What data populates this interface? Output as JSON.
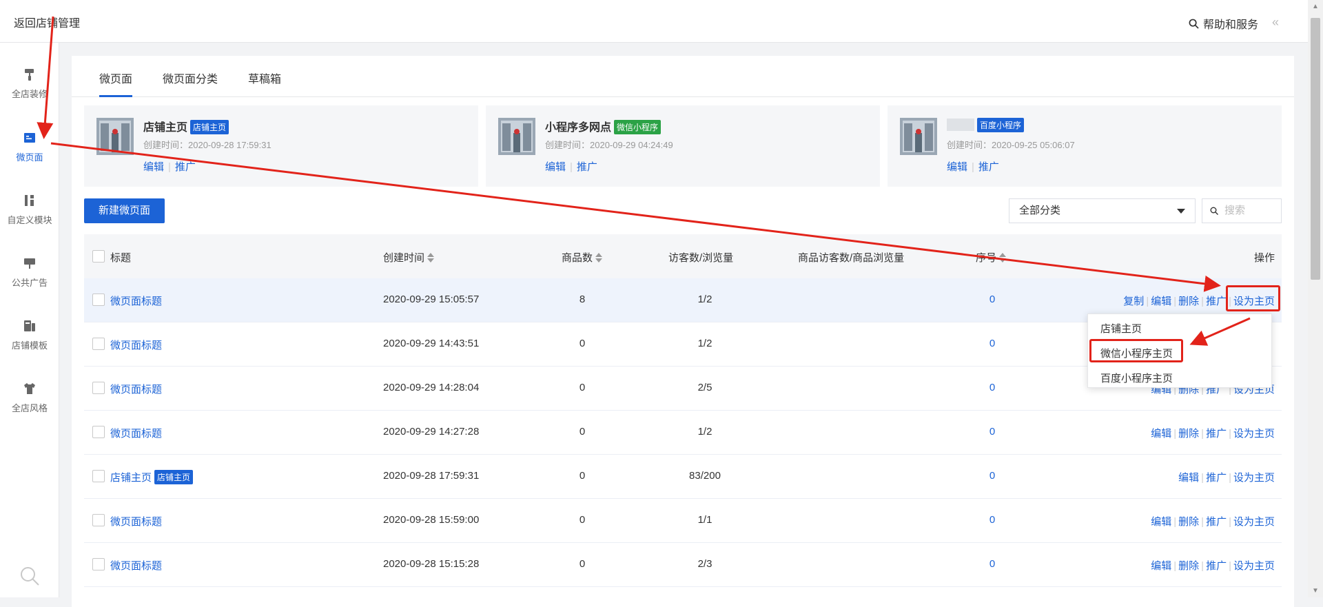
{
  "header": {
    "back_label": "返回店铺管理",
    "help_label": "帮助和服务",
    "collapse_glyph": "«"
  },
  "sidebar": {
    "items": [
      {
        "label": "全店装修",
        "icon": "paint-roller-icon"
      },
      {
        "label": "微页面",
        "icon": "page-icon"
      },
      {
        "label": "自定义模块",
        "icon": "module-icon"
      },
      {
        "label": "公共广告",
        "icon": "billboard-icon"
      },
      {
        "label": "店铺模板",
        "icon": "template-icon"
      },
      {
        "label": "全店风格",
        "icon": "shirt-icon"
      }
    ],
    "active_index": 1
  },
  "tabs": [
    {
      "label": "微页面"
    },
    {
      "label": "微页面分类"
    },
    {
      "label": "草稿箱"
    }
  ],
  "home_cards": [
    {
      "name": "店铺主页",
      "badge": "店铺主页",
      "badge_color": "#1c63d6",
      "created": "创建时间：2020-09-28 17:59:31",
      "edit": "编辑",
      "promote": "推广"
    },
    {
      "name": "小程序多网点",
      "badge": "微信小程序",
      "badge_color": "#2ba246",
      "created": "创建时间：2020-09-29 04:24:49",
      "edit": "编辑",
      "promote": "推广"
    },
    {
      "name": "",
      "badge": "百度小程序",
      "badge_color": "#1c63d6",
      "created": "创建时间：2020-09-25 05:06:07",
      "edit": "编辑",
      "promote": "推广"
    }
  ],
  "toolbar": {
    "new_label": "新建微页面",
    "category_selected": "全部分类",
    "search_placeholder": "搜索"
  },
  "table": {
    "headers": {
      "title": "标题",
      "created": "创建时间",
      "goods": "商品数",
      "visitors": "访客数/浏览量",
      "goods_visitors": "商品访客数/商品浏览量",
      "order": "序号",
      "ops": "操作"
    },
    "rows": [
      {
        "title": "微页面标题",
        "badge": "",
        "created": "2020-09-29 15:05:57",
        "goods": "8",
        "visitors": "1/2",
        "order": "0",
        "ops": [
          "复制",
          "编辑",
          "删除",
          "推广",
          "设为主页"
        ]
      },
      {
        "title": "微页面标题",
        "badge": "",
        "created": "2020-09-29 14:43:51",
        "goods": "0",
        "visitors": "1/2",
        "order": "0",
        "ops": []
      },
      {
        "title": "微页面标题",
        "badge": "",
        "created": "2020-09-29 14:28:04",
        "goods": "0",
        "visitors": "2/5",
        "order": "0",
        "ops": [
          "编辑",
          "删除",
          "推广",
          "设为主页"
        ]
      },
      {
        "title": "微页面标题",
        "badge": "",
        "created": "2020-09-29 14:27:28",
        "goods": "0",
        "visitors": "1/2",
        "order": "0",
        "ops": [
          "编辑",
          "删除",
          "推广",
          "设为主页"
        ]
      },
      {
        "title": "店铺主页",
        "badge": "店铺主页",
        "created": "2020-09-28 17:59:31",
        "goods": "0",
        "visitors": "83/200",
        "order": "0",
        "ops": [
          "编辑",
          "推广",
          "设为主页"
        ]
      },
      {
        "title": "微页面标题",
        "badge": "",
        "created": "2020-09-28 15:59:00",
        "goods": "0",
        "visitors": "1/1",
        "order": "0",
        "ops": [
          "编辑",
          "删除",
          "推广",
          "设为主页"
        ]
      },
      {
        "title": "微页面标题",
        "badge": "",
        "created": "2020-09-28 15:15:28",
        "goods": "0",
        "visitors": "2/3",
        "order": "0",
        "ops": [
          "编辑",
          "删除",
          "推广",
          "设为主页"
        ]
      }
    ]
  },
  "set_home_dropdown": {
    "options": [
      "店铺主页",
      "微信小程序主页",
      "百度小程序主页"
    ],
    "highlighted_index": 1
  },
  "colors": {
    "accent": "#1c63d6",
    "annotation_red": "#e2231a",
    "row_highlight": "#eef3fc"
  }
}
